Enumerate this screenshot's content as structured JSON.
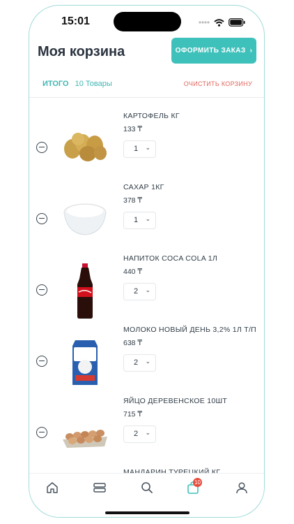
{
  "status_bar": {
    "time": "15:01"
  },
  "header": {
    "title": "Моя корзина",
    "checkout_label": "ОФОРМИТЬ ЗАКАЗ",
    "checkout_chevron": "›"
  },
  "summary": {
    "total_label": "ИТОГО",
    "count": "10 Товары",
    "clear_label": "ОЧИСТИТЬ КОРЗИНУ"
  },
  "items": [
    {
      "name": "КАРТОФЕЛЬ КГ",
      "price": "133 ₸",
      "qty": "1",
      "image": "potatoes"
    },
    {
      "name": "САХАР 1КГ",
      "price": "378 ₸",
      "qty": "1",
      "image": "sugar-bowl"
    },
    {
      "name": "НАПИТОК COCA COLA 1Л",
      "price": "440 ₸",
      "qty": "2",
      "image": "cola-bottle"
    },
    {
      "name": "МОЛОКО НОВЫЙ ДЕНЬ 3,2% 1Л Т/П",
      "price": "638 ₸",
      "qty": "2",
      "image": "milk-carton"
    },
    {
      "name": "ЯЙЦО ДЕРЕВЕНСКОЕ 10ШТ",
      "price": "715 ₸",
      "qty": "2",
      "image": "eggs-tray"
    },
    {
      "name": "МАНДАРИН ТУРЕЦКИЙ КГ"
    }
  ],
  "tabbar": {
    "cart_badge": "10",
    "icons": [
      "home-icon",
      "catalog-icon",
      "search-icon",
      "cart-icon",
      "profile-icon"
    ]
  },
  "colors": {
    "accent": "#3fc1bb",
    "danger": "#e2655c",
    "badge": "#e84b3c"
  }
}
